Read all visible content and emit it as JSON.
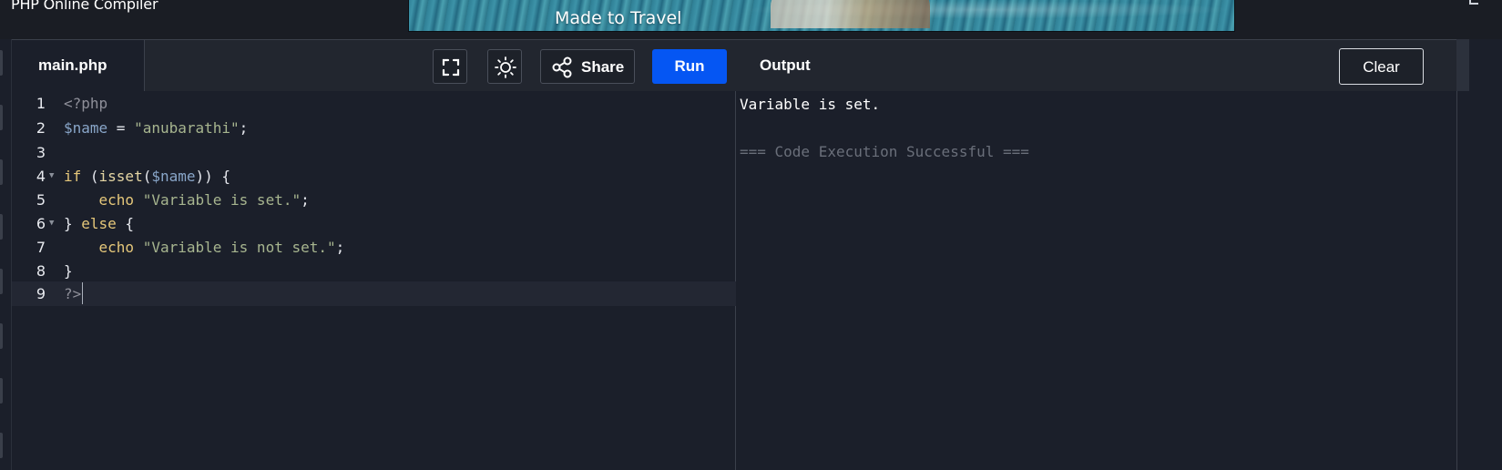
{
  "header": {
    "site_title": "PHP Online Compiler",
    "ad_text": "Made to Travel"
  },
  "editor": {
    "tab_label": "main.php",
    "share_label": "Share",
    "run_label": "Run",
    "icons": [
      "fullscreen-icon",
      "sun-icon",
      "share-icon",
      "fold-arrow-icon"
    ],
    "run_color": "#0556f3",
    "active_line": 9,
    "lines": [
      "<?php",
      "$name = \"anubarathi\";",
      "",
      "if (isset($name)) {",
      "    echo \"Variable is set.\";",
      "} else {",
      "    echo \"Variable is not set.\";",
      "}",
      "?>"
    ],
    "line_numbers": [
      "1",
      "2",
      "3",
      "4",
      "5",
      "6",
      "7",
      "8",
      "9"
    ]
  },
  "output": {
    "title": "Output",
    "clear_label": "Clear",
    "result_line": "Variable is set.",
    "status_line": "=== Code Execution Successful ==="
  }
}
